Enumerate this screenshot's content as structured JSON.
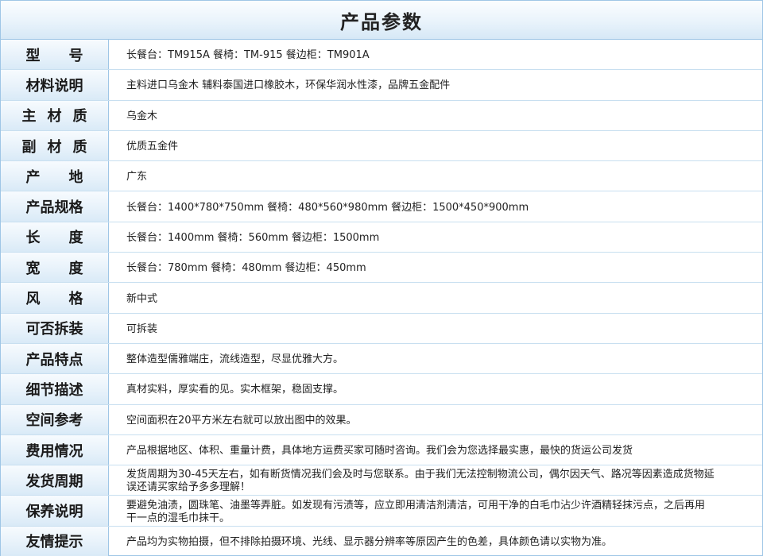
{
  "title": "产品参数",
  "colors": {
    "border": "#9fc6e6",
    "label_background": "#e6f1fa",
    "row_divider": "#c8dff0",
    "text": "#222222"
  },
  "rows": [
    {
      "label": "型号",
      "value": "长餐台：TM915A   餐椅：TM-915   餐边柜：TM901A"
    },
    {
      "label": "材料说明",
      "value": "主料进口乌金木 辅料泰国进口橡胶木，环保华润水性漆，品牌五金配件"
    },
    {
      "label": "主材质",
      "value": "乌金木"
    },
    {
      "label": "副材质",
      "value": "优质五金件"
    },
    {
      "label": "产地",
      "value": "广东"
    },
    {
      "label": "产品规格",
      "value": "长餐台：1400*780*750mm  餐椅：480*560*980mm 餐边柜：1500*450*900mm"
    },
    {
      "label": "长度",
      "value": "长餐台：1400mm  餐椅：560mm 餐边柜：1500mm"
    },
    {
      "label": "宽度",
      "value": "长餐台：780mm  餐椅：480mm 餐边柜：450mm"
    },
    {
      "label": "风格",
      "value": "新中式"
    },
    {
      "label": "可否拆装",
      "value": "可拆装"
    },
    {
      "label": "产品特点",
      "value": "整体造型儒雅端庄，流线造型，尽显优雅大方。"
    },
    {
      "label": "细节描述",
      "value": "真材实料，厚实看的见。实木框架，稳固支撑。"
    },
    {
      "label": "空间参考",
      "value": "空间面积在20平方米左右就可以放出图中的效果。"
    },
    {
      "label": "费用情况",
      "value": "产品根据地区、体积、重量计费，具体地方运费买家可随时咨询。我们会为您选择最实惠，最快的货运公司发货"
    },
    {
      "label": "发货周期",
      "value": "发货周期为30-45天左右，如有断货情况我们会及时与您联系。由于我们无法控制物流公司，偶尔因天气、路况等因素造成货物延误还请买家给予多多理解！"
    },
    {
      "label": "保养说明",
      "value": "要避免油渍，圆珠笔、油墨等弄脏。如发现有污渍等，应立即用清洁剂清洁，可用干净的白毛巾沾少许酒精轻抹污点，之后再用干一点的湿毛巾抹干。"
    },
    {
      "label": "友情提示",
      "value": "产品均为实物拍摄，但不排除拍摄环境、光线、显示器分辨率等原因产生的色差，具体颜色请以实物为准。"
    }
  ]
}
